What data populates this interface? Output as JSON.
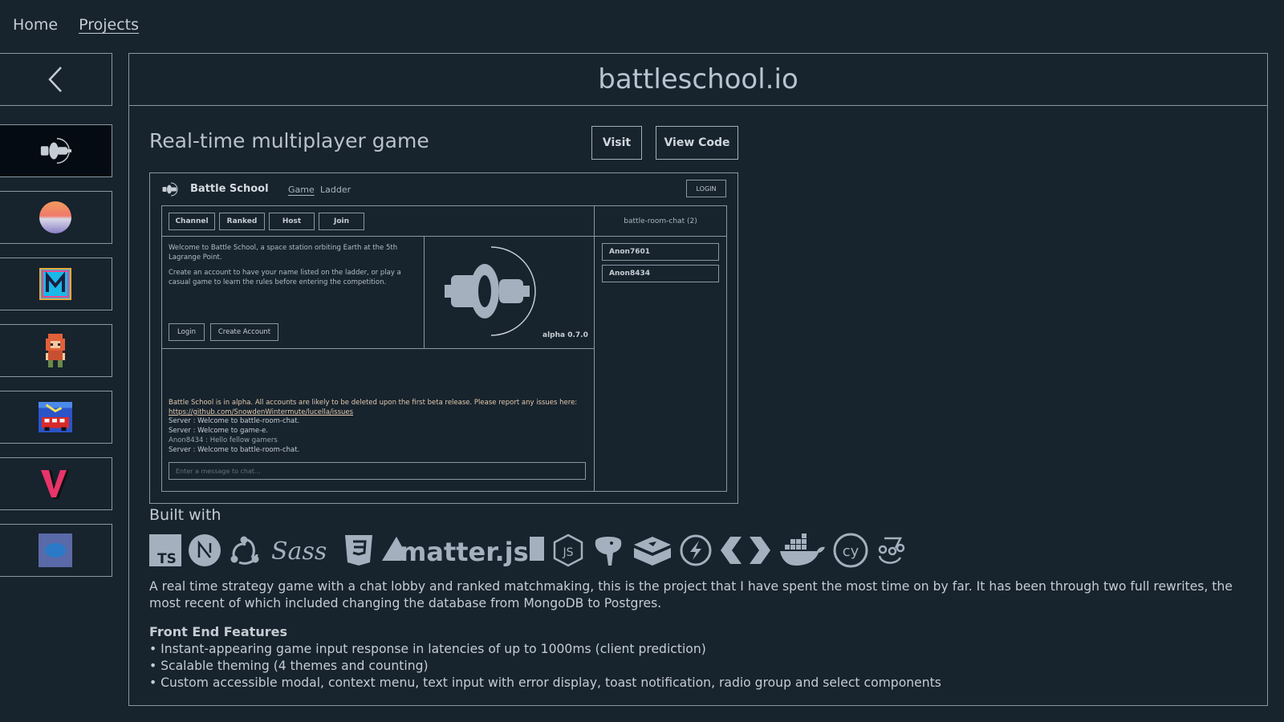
{
  "nav": {
    "home": "Home",
    "projects": "Projects"
  },
  "sidebar": {
    "back_icon": "chevron-left-icon",
    "items": [
      {
        "name": "battleschool",
        "icon": "spaceship-icon",
        "active": true
      },
      {
        "name": "sunset-orb",
        "icon": "sunset-orb-icon",
        "active": false
      },
      {
        "name": "m-logo",
        "icon": "m-logo-icon",
        "active": false
      },
      {
        "name": "pixel-character",
        "icon": "pixel-character-icon",
        "active": false
      },
      {
        "name": "pixel-bus",
        "icon": "pixel-bus-icon",
        "active": false
      },
      {
        "name": "v-logo",
        "icon": "v-logo-icon",
        "active": false
      },
      {
        "name": "blue-blob",
        "icon": "blob-icon",
        "active": false
      }
    ]
  },
  "project": {
    "title": "battleschool.io",
    "subtitle": "Real-time multiplayer game",
    "visit_label": "Visit",
    "code_label": "View Code"
  },
  "preview": {
    "brand": "Battle School",
    "nav_game": "Game",
    "nav_ladder": "Ladder",
    "login": "LOGIN",
    "buttons": {
      "channel": "Channel",
      "ranked": "Ranked",
      "host": "Host",
      "join": "Join"
    },
    "welcome_1": "Welcome to Battle School, a space station orbiting Earth at the 5th Lagrange Point.",
    "welcome_2": "Create an account to have your name listed on the ladder, or play a casual game to learn the rules before entering the competition.",
    "login_btn": "Login",
    "create_btn": "Create Account",
    "version": "alpha 0.7.0",
    "chat": {
      "alpha_notice": "Battle School is in alpha. All accounts are likely to be deleted upon the first beta release. Please report any issues here:",
      "issues_link": "https://github.com/SnowdenWintermute/lucella/issues",
      "line_1": "Server : Welcome to battle-room-chat.",
      "line_2": "Server : Welcome to game-e.",
      "line_3": "Anon8434 : Hello fellow gamers",
      "line_4": "Server : Welcome to battle-room-chat."
    },
    "chat_placeholder": "Enter a message to chat...",
    "room_title": "battle-room-chat (2)",
    "users": [
      "Anon7601",
      "Anon8434"
    ]
  },
  "built_with": {
    "label": "Built with",
    "matter_label": "matter.js",
    "tech_icons": [
      "typescript-icon",
      "nextjs-icon",
      "redux-icon",
      "sass-icon",
      "css3-icon",
      "matterjs-icon",
      "nodejs-icon",
      "postgresql-icon",
      "redis-icon",
      "socketio-icon",
      "protobuf-icon",
      "docker-icon",
      "cypress-icon",
      "jest-icon"
    ]
  },
  "description": "A real time strategy game with a chat lobby and ranked matchmaking, this is the project that I have spent the most time on by far. It has been through two full rewrites, the most recent of which included changing the database from MongoDB to Postgres.",
  "features": {
    "title": "Front End Features",
    "items": [
      "Instant-appearing game input response in latencies of up to 1000ms (client prediction)",
      "Scalable theming (4 themes and counting)",
      "Custom accessible modal, context menu, text input with error display, toast notification, radio group and select components"
    ]
  },
  "colors": {
    "background": "#17232d",
    "border": "#8a96a3",
    "text": "#c5ccd3",
    "icon": "#a4b0bd",
    "warning": "#e2c9ae"
  }
}
